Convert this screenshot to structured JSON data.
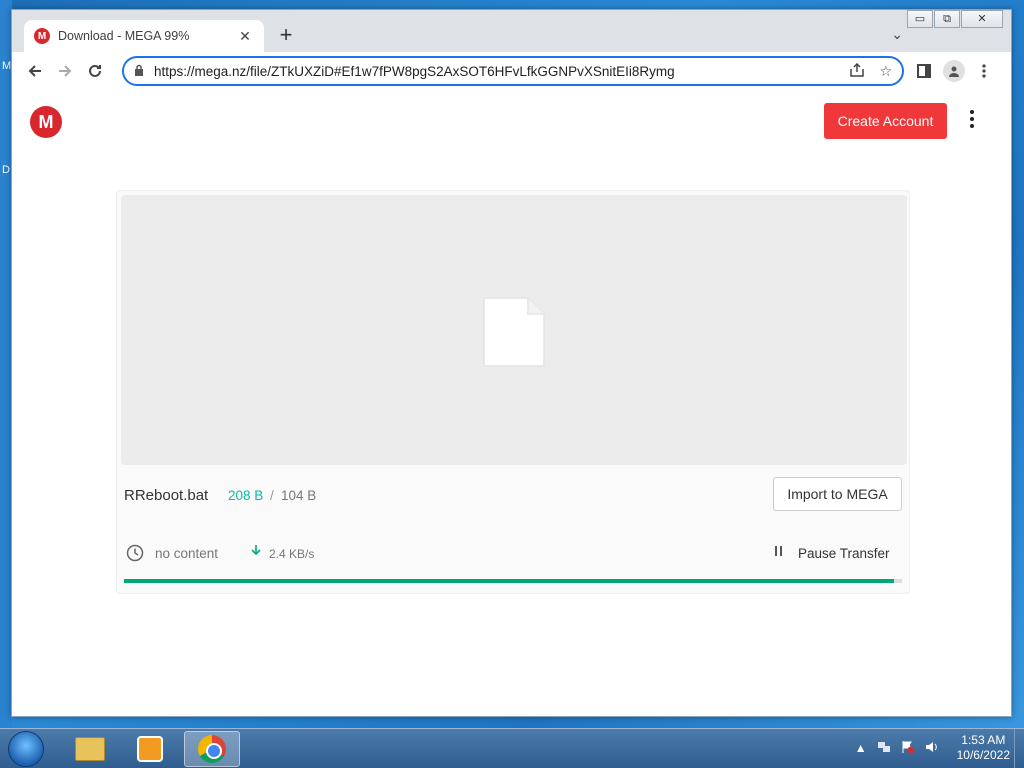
{
  "desktop": {
    "fragments": [
      "M",
      "D"
    ]
  },
  "browser": {
    "tab": {
      "title": "Download - MEGA 99%",
      "favicon": "M",
      "close_icon": "✕"
    },
    "new_tab_icon": "+",
    "tab_search_icon": "⌄",
    "window_controls": [
      "▭",
      "⧉",
      "✕"
    ],
    "address": {
      "url": "https://mega.nz/file/ZTkUXZiD#Ef1w7fPW8pgS2AxSOT6HFvLfkGGNPvXSnitEIi8Rymg"
    }
  },
  "page": {
    "logo": "M",
    "create_account": "Create Account",
    "file": {
      "name": "RReboot.bat",
      "downloaded": "208 B",
      "separator": "/",
      "total": "104 B"
    },
    "import_button": "Import to MEGA",
    "status": {
      "time_left": "no content",
      "speed": "2.4 KB/s",
      "pause_label": "Pause Transfer"
    },
    "progress_percent": 99
  },
  "taskbar": {
    "time": "1:53 AM",
    "date": "10/6/2022"
  },
  "colors": {
    "accent": "#1a73e8",
    "mega_red": "#d9272e",
    "progress_green": "#00a878",
    "downloaded_teal": "#00bfa5"
  }
}
